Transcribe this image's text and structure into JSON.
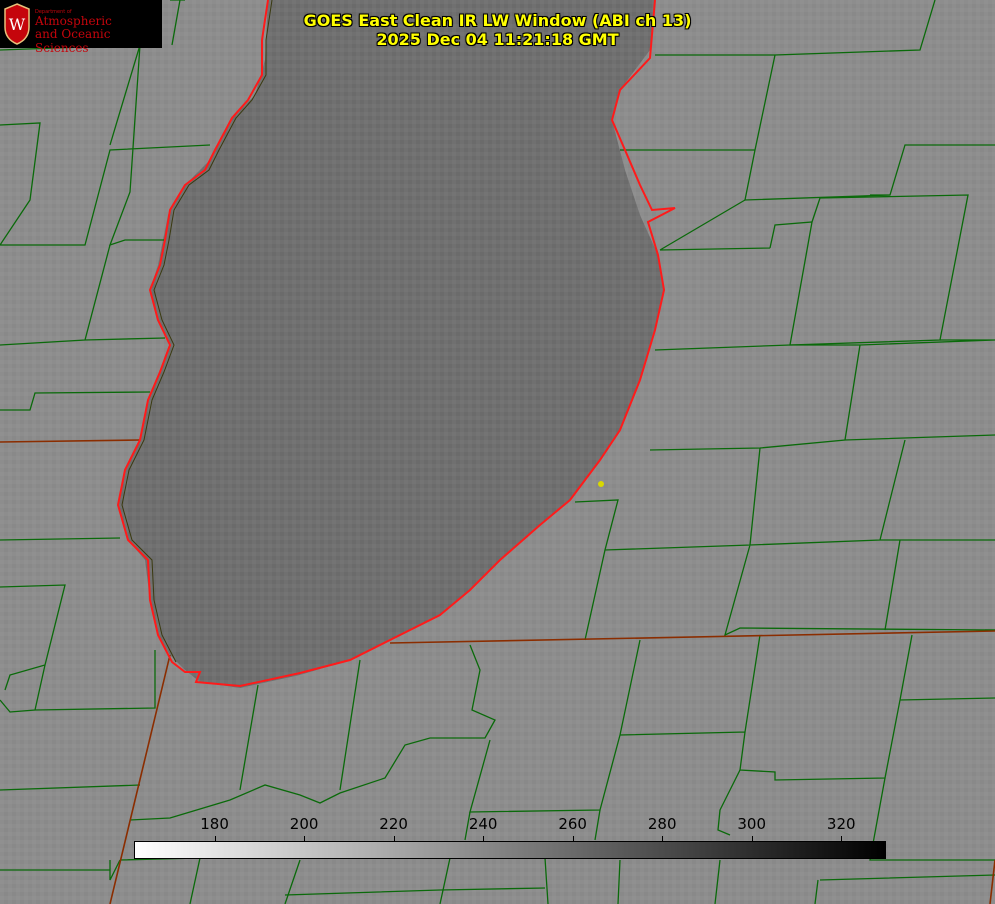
{
  "header": {
    "title_line1": "GOES East Clean IR LW Window (ABI ch 13)",
    "title_line2": "2025 Dec 04 11:21:18 GMT"
  },
  "logo": {
    "small_text": "Department of",
    "line1": "Atmospheric",
    "line2": "and Oceanic Sciences",
    "emblem_letter": "W",
    "brand_color": "#c5050c"
  },
  "colorbar": {
    "ticks": [
      "180",
      "200",
      "220",
      "240",
      "260",
      "280",
      "300",
      "320"
    ],
    "tick_values": [
      180,
      200,
      220,
      240,
      260,
      280,
      300,
      320
    ],
    "range": [
      162,
      330
    ],
    "start_color": "#ffffff",
    "end_color": "#000000"
  },
  "map": {
    "lake_color": "#6f6f6f",
    "land_color": "#8c8c8c",
    "county_line_color": "#0a6a0a",
    "state_line_color": "#8b2d00",
    "shoreline_color": "#ff1a1a",
    "marker_color": "#d8d800"
  }
}
